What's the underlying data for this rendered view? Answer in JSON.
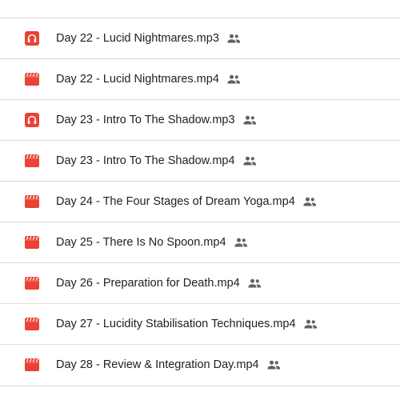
{
  "colors": {
    "video": "#ea4335",
    "audio": "#ea4335",
    "text": "#202124",
    "shared_icon": "#5f6368",
    "divider": "#dadce0"
  },
  "files": [
    {
      "name": "Day 22 - Lucid Nightmares.mp3",
      "type_icon": "headphones-icon",
      "shared_icon": "people-icon"
    },
    {
      "name": "Day 22 - Lucid Nightmares.mp4",
      "type_icon": "video-clapper-icon",
      "shared_icon": "people-icon"
    },
    {
      "name": "Day 23 - Intro To The Shadow.mp3",
      "type_icon": "headphones-icon",
      "shared_icon": "people-icon"
    },
    {
      "name": "Day 23 - Intro To The Shadow.mp4",
      "type_icon": "video-clapper-icon",
      "shared_icon": "people-icon"
    },
    {
      "name": "Day 24 - The Four Stages of Dream Yoga.mp4",
      "type_icon": "video-clapper-icon",
      "shared_icon": "people-icon"
    },
    {
      "name": "Day 25 - There Is No Spoon.mp4",
      "type_icon": "video-clapper-icon",
      "shared_icon": "people-icon"
    },
    {
      "name": "Day 26 - Preparation for Death.mp4",
      "type_icon": "video-clapper-icon",
      "shared_icon": "people-icon"
    },
    {
      "name": "Day 27 - Lucidity Stabilisation Techniques.mp4",
      "type_icon": "video-clapper-icon",
      "shared_icon": "people-icon"
    },
    {
      "name": "Day 28 - Review & Integration Day.mp4",
      "type_icon": "video-clapper-icon",
      "shared_icon": "people-icon"
    }
  ]
}
